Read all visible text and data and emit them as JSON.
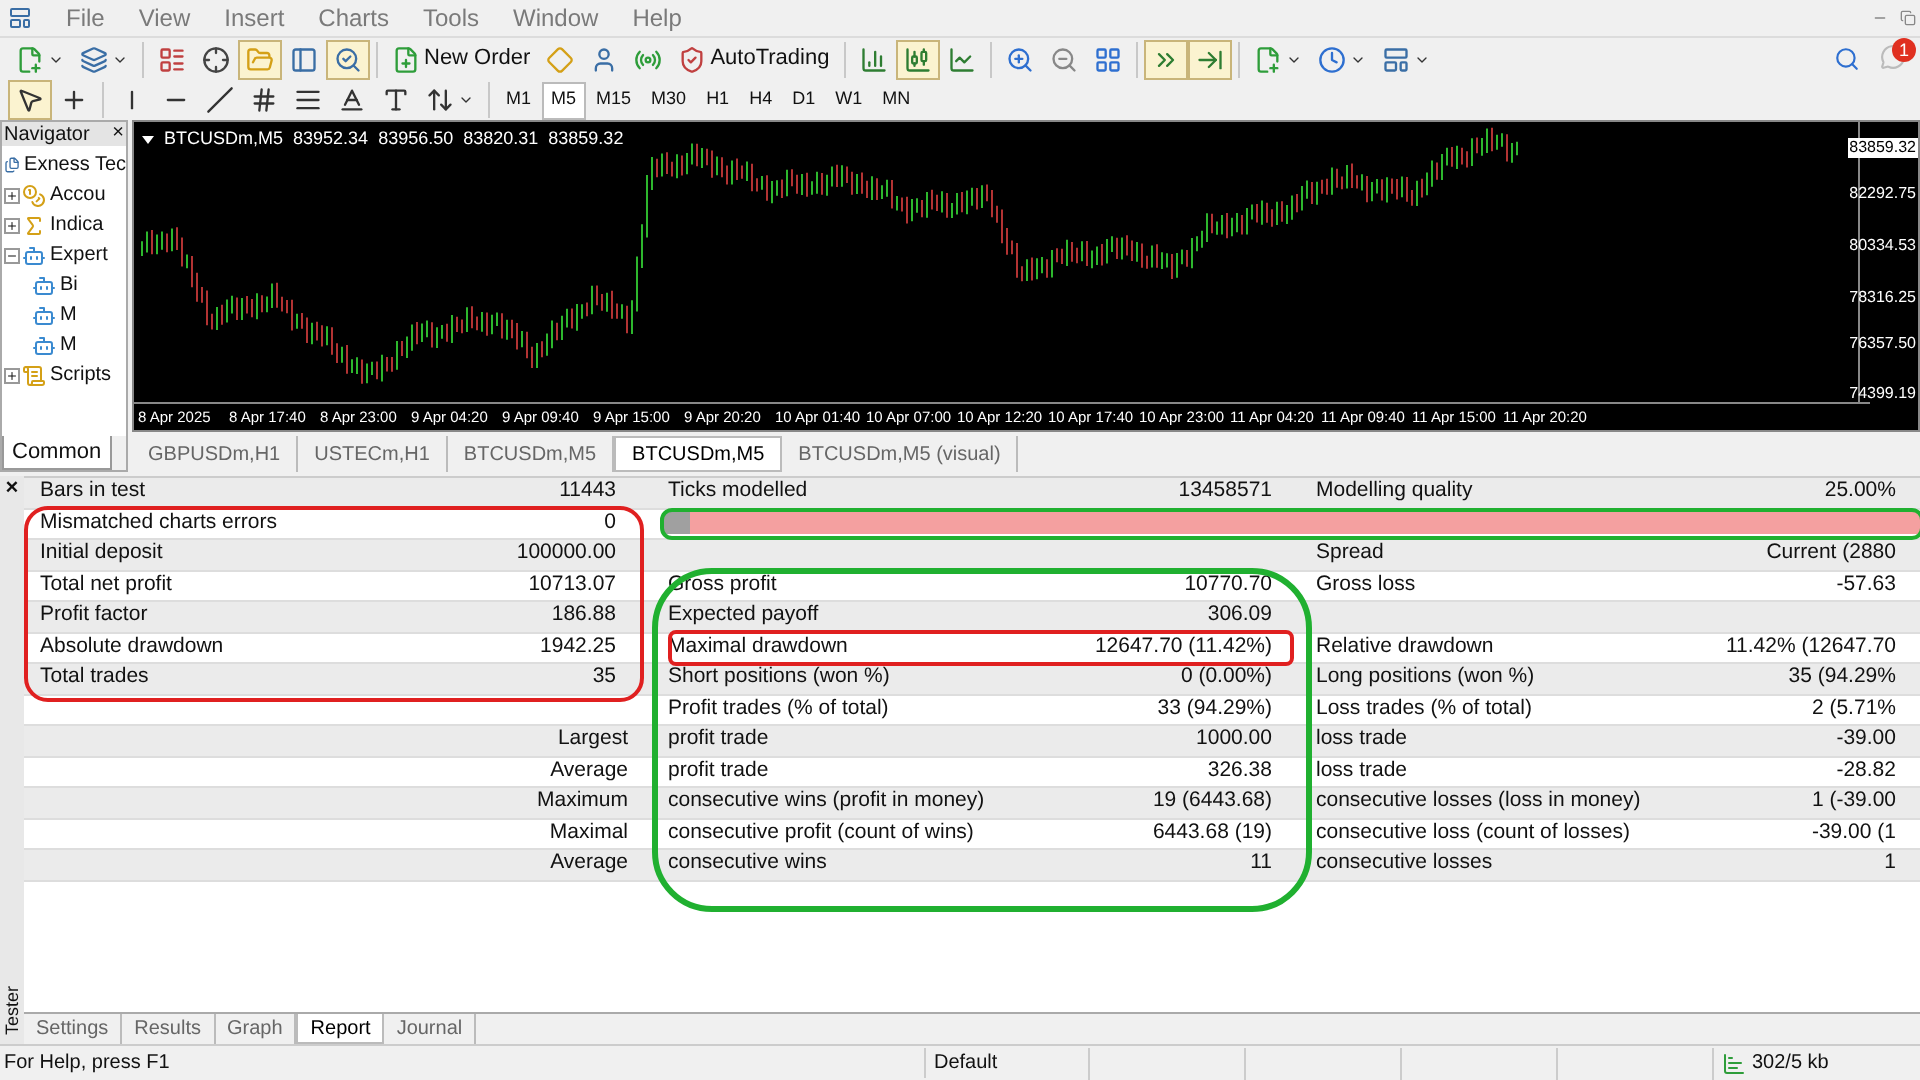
{
  "menu": [
    "File",
    "View",
    "Insert",
    "Charts",
    "Tools",
    "Window",
    "Help"
  ],
  "toolbar": {
    "groups": [
      [
        {
          "pressed": false,
          "dropdown": true
        },
        {
          "pressed": false,
          "dropdown": true
        }
      ],
      [
        {
          "pressed": false,
          "dropdown": false
        },
        {
          "pressed": false,
          "dropdown": false
        },
        {
          "pressed": true,
          "dropdown": false
        },
        {
          "pressed": false,
          "dropdown": false
        },
        {
          "pressed": true,
          "dropdown": false
        }
      ],
      [
        {
          "label": "New Order",
          "pressed": false,
          "dropdown": false
        },
        {
          "pressed": false,
          "dropdown": false
        },
        {
          "pressed": false,
          "dropdown": false
        },
        {
          "pressed": false,
          "dropdown": false
        },
        {
          "label": "AutoTrading",
          "pressed": false,
          "dropdown": false
        }
      ],
      [
        {
          "pressed": false,
          "dropdown": false
        },
        {
          "pressed": true,
          "dropdown": false
        },
        {
          "pressed": false,
          "dropdown": false
        }
      ],
      [
        {
          "pressed": false,
          "dropdown": false
        },
        {
          "pressed": false,
          "dropdown": false
        },
        {
          "pressed": false,
          "dropdown": false
        }
      ],
      [
        {
          "pressed": true,
          "dropdown": false
        },
        {
          "pressed": true,
          "dropdown": false
        }
      ],
      [
        {
          "pressed": false,
          "dropdown": true
        },
        {
          "pressed": false,
          "dropdown": true
        },
        {
          "pressed": false,
          "dropdown": true
        }
      ]
    ],
    "notification_count": "1"
  },
  "drawing_toolbar": {
    "tools": [
      [
        {
          "pressed": true,
          "dropdown": false
        },
        {
          "pressed": false,
          "dropdown": false
        }
      ],
      [
        {
          "pressed": false,
          "dropdown": false
        },
        {
          "pressed": false,
          "dropdown": false
        },
        {
          "pressed": false,
          "dropdown": false
        },
        {
          "pressed": false,
          "dropdown": false
        },
        {
          "pressed": false,
          "dropdown": false
        },
        {
          "pressed": false,
          "dropdown": false
        },
        {
          "pressed": false,
          "dropdown": false
        },
        {
          "pressed": false,
          "dropdown": true
        }
      ]
    ],
    "timeframes": [
      {
        "label": "M1",
        "selected": false
      },
      {
        "label": "M5",
        "selected": true
      },
      {
        "label": "M15",
        "selected": false
      },
      {
        "label": "M30",
        "selected": false
      },
      {
        "label": "H1",
        "selected": false
      },
      {
        "label": "H4",
        "selected": false
      },
      {
        "label": "D1",
        "selected": false
      },
      {
        "label": "W1",
        "selected": false
      },
      {
        "label": "MN",
        "selected": false
      }
    ]
  },
  "navigator": {
    "title": "Navigator",
    "close": "×",
    "tree": [
      {
        "label": "Exness Tec",
        "children": [
          {
            "label": "Accou",
            "expanded": false
          },
          {
            "label": "Indica",
            "expanded": false
          },
          {
            "label": "Expert",
            "expanded": true,
            "children": [
              {
                "label": "Bi"
              },
              {
                "label": "M"
              },
              {
                "label": "M"
              }
            ]
          },
          {
            "label": "Scripts",
            "expanded": false
          }
        ]
      }
    ],
    "tabs": [
      {
        "label": "Common",
        "selected": true
      }
    ]
  },
  "chart": {
    "symbol": "BTCUSDm,M5",
    "prices": [
      "83952.34",
      "83956.50",
      "83820.31",
      "83859.32"
    ],
    "price_axis": [
      {
        "label": "83859.32",
        "current": true
      },
      {
        "label": "82292.75",
        "current": false
      },
      {
        "label": "80334.53",
        "current": false
      },
      {
        "label": "78316.25",
        "current": false
      },
      {
        "label": "76357.50",
        "current": false
      },
      {
        "label": "74399.19",
        "current": false
      }
    ],
    "time_axis": [
      "8 Apr 2025",
      "8 Apr 17:40",
      "8 Apr 23:00",
      "9 Apr 04:20",
      "9 Apr 09:40",
      "9 Apr 15:00",
      "9 Apr 20:20",
      "10 Apr 01:40",
      "10 Apr 07:00",
      "10 Apr 12:20",
      "10 Apr 17:40",
      "10 Apr 23:00",
      "11 Apr 04:20",
      "11 Apr 09:40",
      "11 Apr 15:00",
      "11 Apr 20:20"
    ]
  },
  "chart_tabs": [
    {
      "label": "GBPUSDm,H1",
      "selected": false
    },
    {
      "label": "USTECm,H1",
      "selected": false
    },
    {
      "label": "BTCUSDm,M5",
      "selected": false
    },
    {
      "label": "BTCUSDm,M5",
      "selected": true
    },
    {
      "label": "BTCUSDm,M5 (visual)",
      "selected": false
    }
  ],
  "tester": {
    "title": "Tester",
    "close": "×",
    "report": [
      {
        "kind": "stat",
        "left": {
          "label": "Bars in test",
          "value": "11443"
        },
        "middle": {
          "label": "Ticks modelled",
          "value": "13458571"
        },
        "right": {
          "label": "Modelling quality",
          "value": "25.00%"
        }
      },
      {
        "kind": "bar",
        "left": {
          "label": "Mismatched charts errors",
          "value": "0"
        },
        "level": 0.02
      },
      {
        "kind": "stat",
        "left": {
          "label": "Initial deposit",
          "value": "100000.00"
        },
        "right": {
          "label": "Spread",
          "value": "Current (2880"
        }
      },
      {
        "kind": "stat",
        "left": {
          "label": "Total net profit",
          "value": "10713.07"
        },
        "middle": {
          "label": "Gross profit",
          "value": "10770.70"
        },
        "right": {
          "label": "Gross loss",
          "value": "-57.63"
        }
      },
      {
        "kind": "stat",
        "left": {
          "label": "Profit factor",
          "value": "186.88"
        },
        "middle": {
          "label": "Expected payoff",
          "value": "306.09"
        }
      },
      {
        "kind": "stat",
        "left": {
          "label": "Absolute drawdown",
          "value": "1942.25"
        },
        "middle": {
          "label": "Maximal drawdown",
          "value": "12647.70 (11.42%)"
        },
        "right": {
          "label": "Relative drawdown",
          "value": "11.42% (12647.70"
        }
      },
      {
        "kind": "stat",
        "left": {
          "label": "Total trades",
          "value": "35"
        },
        "middle": {
          "label": "Short positions (won %)",
          "value": "0 (0.00%)"
        },
        "right": {
          "label": "Long positions (won %)",
          "value": "35 (94.29%"
        }
      },
      {
        "kind": "stat",
        "middle": {
          "label": "Profit trades (% of total)",
          "value": "33 (94.29%)"
        },
        "right": {
          "label": "Loss trades (% of total)",
          "value": "2 (5.71%"
        }
      },
      {
        "kind": "group",
        "group": "Largest",
        "cols": [
          {
            "label": "profit trade",
            "value": "1000.00"
          },
          {
            "label": "loss trade",
            "value": "-39.00"
          }
        ]
      },
      {
        "kind": "group",
        "group": "Average",
        "cols": [
          {
            "label": "profit trade",
            "value": "326.38"
          },
          {
            "label": "loss trade",
            "value": "-28.82"
          }
        ]
      },
      {
        "kind": "group",
        "group": "Maximum",
        "cols": [
          {
            "label": "consecutive wins (profit in money)",
            "value": "19 (6443.68)"
          },
          {
            "label": "consecutive losses (loss in money)",
            "value": "1 (-39.00"
          }
        ]
      },
      {
        "kind": "group",
        "group": "Maximal",
        "cols": [
          {
            "label": "consecutive profit (count of wins)",
            "value": "6443.68 (19)"
          },
          {
            "label": "consecutive loss (count of losses)",
            "value": "-39.00 (1"
          }
        ]
      },
      {
        "kind": "group",
        "group": "Average",
        "cols": [
          {
            "label": "consecutive wins",
            "value": "11"
          },
          {
            "label": "consecutive losses",
            "value": "1"
          }
        ]
      }
    ],
    "tabs": [
      {
        "label": "Settings",
        "selected": false
      },
      {
        "label": "Results",
        "selected": false
      },
      {
        "label": "Graph",
        "selected": false
      },
      {
        "label": "Report",
        "selected": true
      },
      {
        "label": "Journal",
        "selected": false
      }
    ]
  },
  "status_bar": {
    "help": "For Help, press F1",
    "profile": "Default",
    "traffic": "302/5 kb"
  }
}
